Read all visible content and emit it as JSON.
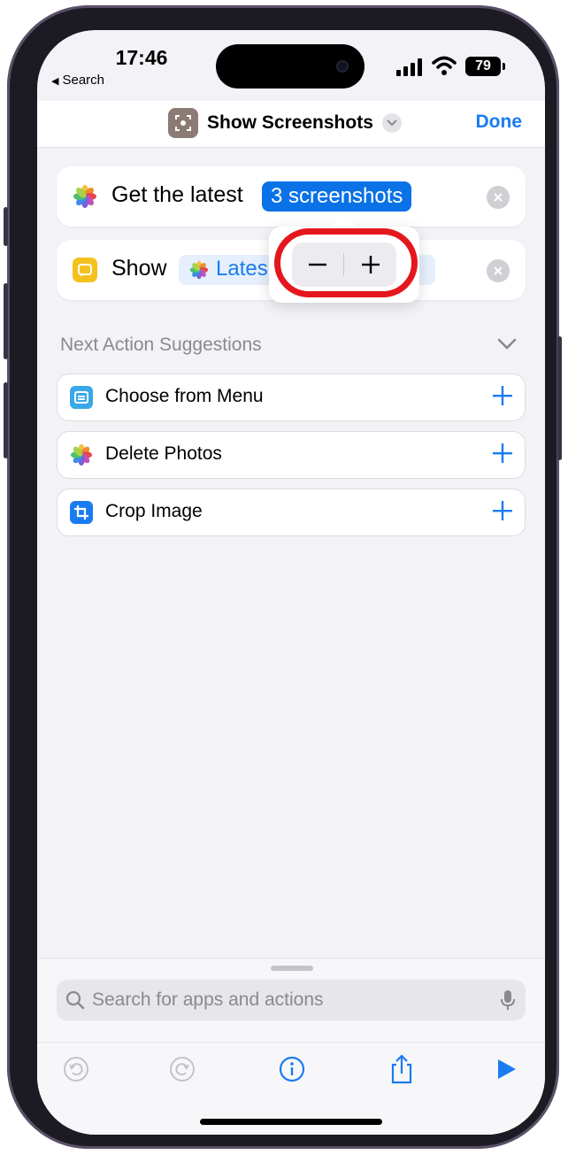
{
  "status_bar": {
    "time": "17:46",
    "back_label": "Search",
    "battery": "79"
  },
  "navbar": {
    "title": "Show Screenshots",
    "done_label": "Done"
  },
  "actions": [
    {
      "label": "Get the latest",
      "chip": "3 screenshots"
    },
    {
      "label": "Show",
      "chip": "Lates"
    }
  ],
  "stepper": {
    "minus": "−",
    "plus": "+"
  },
  "suggestions": {
    "header": "Next Action Suggestions",
    "items": [
      {
        "label": "Choose from Menu",
        "icon": "menu-icon",
        "color": "#38a8e8"
      },
      {
        "label": "Delete Photos",
        "icon": "photos-icon",
        "color": "#ffffff"
      },
      {
        "label": "Crop Image",
        "icon": "crop-icon",
        "color": "#1a7cf0"
      }
    ]
  },
  "search": {
    "placeholder": "Search for apps and actions"
  },
  "colors": {
    "accent": "#1a7cf0",
    "highlight": "#e4171d",
    "chip": "#0a72e6"
  }
}
